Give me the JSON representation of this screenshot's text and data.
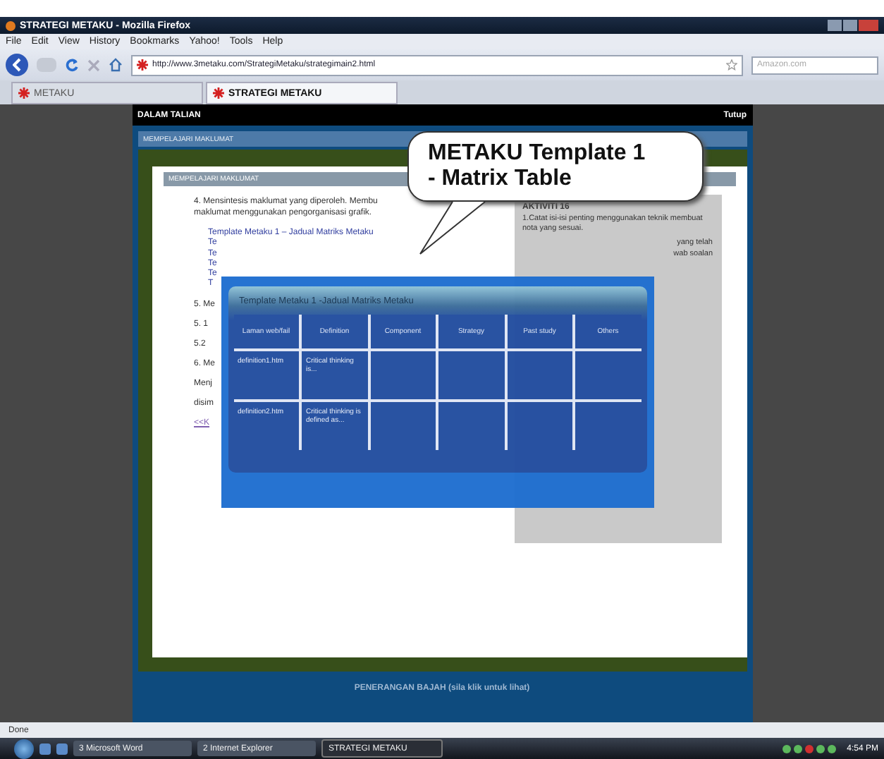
{
  "window": {
    "title": "STRATEGI METAKU - Mozilla Firefox"
  },
  "menu": [
    "File",
    "Edit",
    "View",
    "History",
    "Bookmarks",
    "Yahoo!",
    "Tools",
    "Help"
  ],
  "address": {
    "value": "http://www.3metaku.com/StrategiMetaku/strategimain2.html"
  },
  "search": {
    "placeholder": "Amazon.com"
  },
  "tabs": [
    {
      "label": "METAKU",
      "selected": false
    },
    {
      "label": "STRATEGI METAKU",
      "selected": true
    }
  ],
  "page": {
    "header": "DALAM TALIAN",
    "close": "Tutup",
    "outer_title": "MEMPELAJARI MAKLUMAT",
    "inner_title": "MEMPELAJARI MAKLUMAT",
    "paragraph": [
      "4. Mensintesis maklumat yang diperoleh. Membu",
      "maklumat menggunakan pengorganisasi grafik."
    ],
    "link": "Template Metaku 1 – Jadual Matriks Metaku",
    "fragments": [
      "Te",
      "Te",
      "Te",
      "Te",
      "T"
    ],
    "items": [
      "5. Me",
      "5. 1",
      "5.2",
      "6. Me",
      "Menj",
      "disim"
    ],
    "back_link": "<<K",
    "sidebar": {
      "title": "AKTIVITI 16",
      "text": "1.Catat isi-isi penting menggunakan teknik membuat nota yang sesuai.",
      "fragments": [
        "yang telah",
        "wab soalan"
      ]
    },
    "footer": "PENERANGAN BAJAH (sila klik untuk lihat)"
  },
  "popup": {
    "title": "Template Metaku 1 -Jadual Matriks Metaku",
    "columns": [
      "Laman web/fail",
      "Definition",
      "Component",
      "Strategy",
      "Past study",
      "Others"
    ],
    "rows": [
      [
        "definition1.htm",
        "Critical thinking is..."
      ],
      [
        "definition2.htm",
        "Critical thinking is defined as..."
      ]
    ]
  },
  "callout": "METAKU Template 1 - Matrix Table",
  "status": "Done",
  "taskbar": {
    "buttons": [
      {
        "label": "3 Microsoft Word",
        "selected": false
      },
      {
        "label": "2 Internet Explorer",
        "selected": false
      },
      {
        "label": "STRATEGI METAKU",
        "selected": true
      }
    ],
    "clock": "4:54 PM"
  }
}
